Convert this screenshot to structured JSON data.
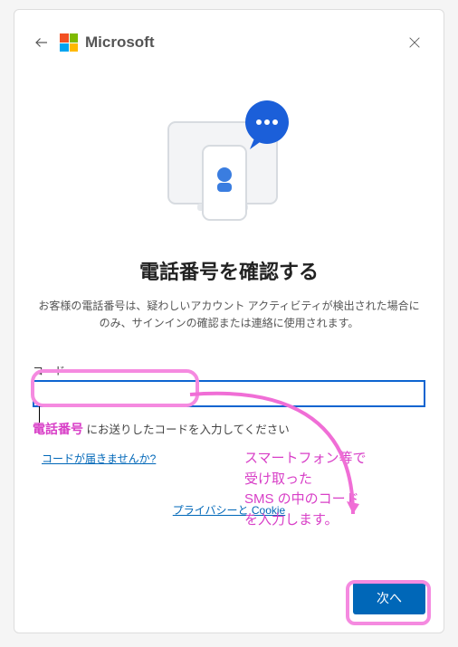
{
  "header": {
    "brand": "Microsoft"
  },
  "main": {
    "heading": "電話番号を確認する",
    "subtext": "お客様の電話番号は、疑わしいアカウント アクティビティが検出された場合にのみ、サインインの確認または連絡に使用されます。",
    "code_label": "コード",
    "code_value": "",
    "hint_prefix_annot": "電話番号",
    "hint_suffix": " にお送りしたコードを入力してください",
    "resend_link": "コードが届きませんか?",
    "privacy_link": "プライバシーと Cookie"
  },
  "footer": {
    "next_label": "次へ"
  },
  "annotations": {
    "sms_instruction": "スマートフォン等で\n受け取った\nSMS の中のコード\nを入力します。"
  }
}
